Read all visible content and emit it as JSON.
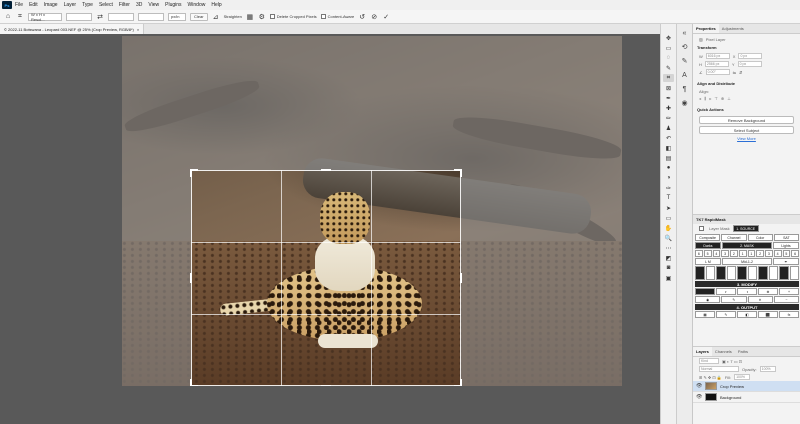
{
  "app": {
    "logo": "Ps"
  },
  "menu": [
    "File",
    "Edit",
    "Image",
    "Layer",
    "Type",
    "Select",
    "Filter",
    "3D",
    "View",
    "Plugins",
    "Window",
    "Help"
  ],
  "options": {
    "ratio": "W x H x Resol...",
    "units": "px/in",
    "clear": "Clear",
    "straighten": "Straighten",
    "delete_cropped": "Delete Cropped Pixels",
    "content_aware": "Content-Aware"
  },
  "document": {
    "tab_title": "© 2022-11 Botswana - Leopard 003.NEF @ 25% (Crop Preview, RGB/8*)"
  },
  "properties": {
    "tabs": [
      "Properties",
      "Adjustments"
    ],
    "layer_type": "Pixel Layer",
    "transform_title": "Transform",
    "w": "6016 px",
    "x": "0 px",
    "h": "2566 px",
    "y": "0 px",
    "angle": "0.00°",
    "align_title": "Align and Distribute",
    "align_label": "Align:",
    "quick_title": "Quick Actions",
    "remove_bg": "Remove Background",
    "select_subject": "Select Subject",
    "view_more": "View More"
  },
  "rapidmask": {
    "title": "TK7 RapidMask",
    "layer_mask": "Layer Mask",
    "source": "1. SOURCE",
    "source_tabs": [
      "Composite",
      "Channel",
      "Color",
      "SAT"
    ],
    "mask": "2. MASK",
    "darks": "Darks",
    "lights": "Lights",
    "zones": [
      "6",
      "5",
      "4",
      "3",
      "2",
      "1",
      "1",
      "2",
      "3",
      "4",
      "5",
      "6"
    ],
    "modify": "3. MODIFY",
    "output": "4. OUTPUT",
    "mid": "Mid-1-2",
    "lm": "L M"
  },
  "layers": {
    "tabs": [
      "Layers",
      "Channels",
      "Paths"
    ],
    "kind": "Kind",
    "blend": "Normal",
    "opacity_label": "Opacity:",
    "opacity": "100%",
    "fill_label": "Fill:",
    "fill": "100%",
    "items": [
      {
        "name": "Crop Preview",
        "selected": true
      },
      {
        "name": "Background",
        "selected": false
      }
    ]
  }
}
